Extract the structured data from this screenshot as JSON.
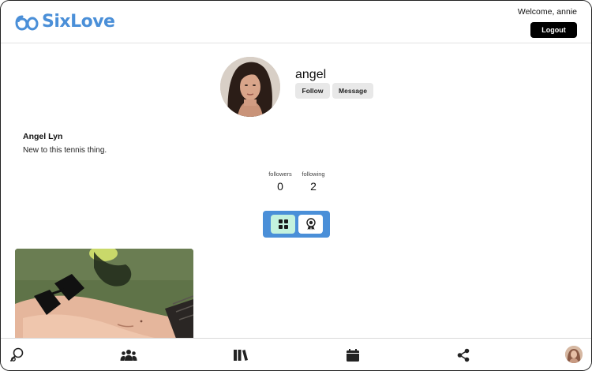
{
  "header": {
    "logo_text": "SixLove",
    "welcome_text": "Welcome, annie",
    "logout_label": "Logout"
  },
  "profile": {
    "username": "angel",
    "follow_label": "Follow",
    "message_label": "Message",
    "full_name": "Angel Lyn",
    "bio": "New to this tennis thing.",
    "stats": {
      "followers_label": "followers",
      "followers_value": "0",
      "following_label": "following",
      "following_value": "2"
    }
  },
  "view_toggle": {
    "options": [
      "grid-icon",
      "award-icon"
    ],
    "selected": "grid-icon"
  },
  "bottom_nav": {
    "items": [
      "search-person-icon",
      "community-icon",
      "library-icon",
      "calendar-icon",
      "share-icon",
      "profile-avatar"
    ]
  },
  "colors": {
    "brand": "#4a8fd8",
    "toggle_active": "#c4f2de",
    "button_dark": "#000000",
    "button_gray": "#e8e8e8"
  }
}
